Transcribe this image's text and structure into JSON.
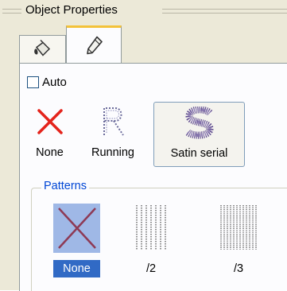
{
  "panel": {
    "title": "Object Properties"
  },
  "tabs": [
    {
      "name": "Fill",
      "icon": "paint-bucket-icon"
    },
    {
      "name": "Outline",
      "icon": "pen-nib-icon"
    }
  ],
  "auto_checkbox": {
    "label": "Auto",
    "checked": false
  },
  "stitch_types": [
    {
      "label": "None",
      "icon": "red-x-icon",
      "selected": false
    },
    {
      "label": "Running",
      "icon": "running-stitch-r-icon",
      "selected": false
    },
    {
      "label": "Satin serial",
      "icon": "satin-s-icon",
      "selected": true
    }
  ],
  "patterns": {
    "group_label": "Patterns",
    "items": [
      {
        "label": "None",
        "icon": "none-pattern-icon",
        "selected": true
      },
      {
        "label": "/2",
        "icon": "pattern-2-icon",
        "selected": false
      },
      {
        "label": "/3",
        "icon": "pattern-3-icon",
        "selected": false
      }
    ]
  },
  "colors": {
    "red_x": "#e4231b",
    "selection": "#316ac5",
    "selection_bg": "#9fb8e6",
    "group_title": "#0046d5",
    "tab_highlight": "#f3c23a"
  }
}
